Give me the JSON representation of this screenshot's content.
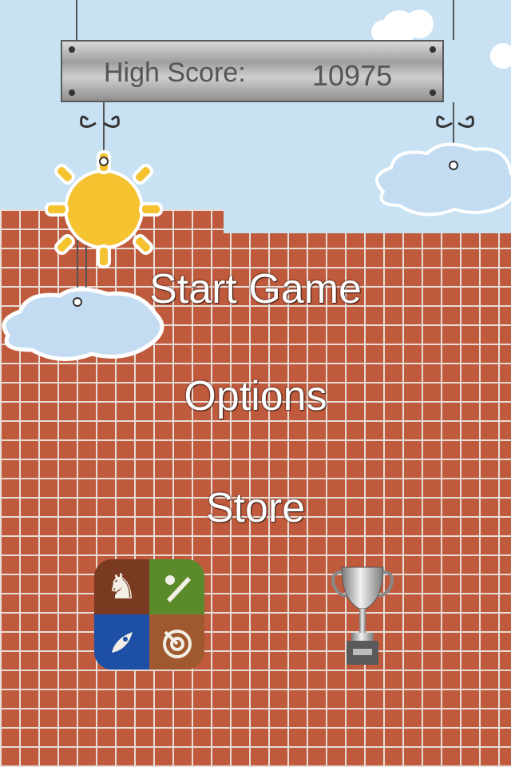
{
  "high_score": {
    "label": "High Score:",
    "value": "10975"
  },
  "menu": {
    "start": "Start Game",
    "options": "Options",
    "store": "Store"
  },
  "icons": {
    "game_center": "game-center-icon",
    "leaderboard": "trophy-icon"
  },
  "colors": {
    "sky": "#c8e2f4",
    "brick": "#bf5a3c",
    "mortar": "#e7ddd6",
    "sun": "#f5c230",
    "cloud": "#c4dcf2"
  }
}
